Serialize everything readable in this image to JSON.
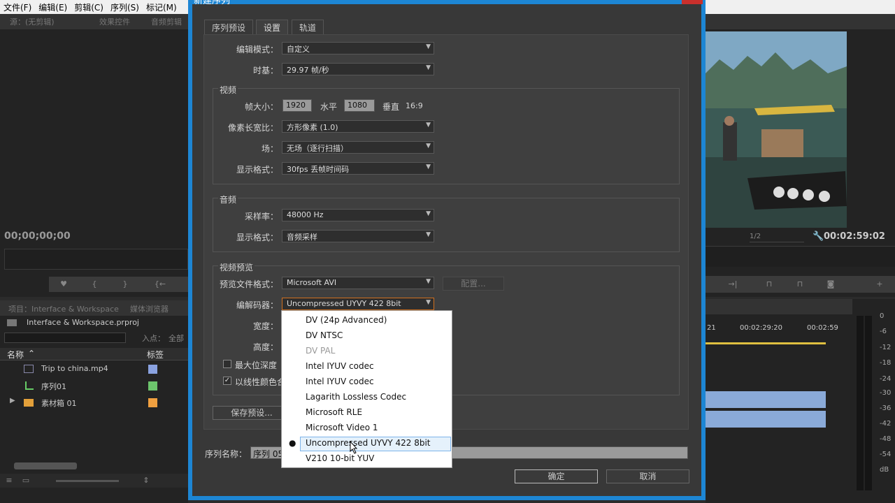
{
  "menubar": {
    "items": [
      "文件(F)",
      "编辑(E)",
      "剪辑(C)",
      "序列(S)",
      "标记(M)"
    ]
  },
  "source_panel": {
    "tab_source": "源：(无剪辑)",
    "tab_effects": "效果控件",
    "tab_audio": "音频剪辑",
    "timecode": "00;00;00;00"
  },
  "project_panel": {
    "tab_project": "项目：Interface & Workspace",
    "tab_media": "媒体浏览器",
    "file_name": "Interface & Workspace.prproj",
    "in_point_label": "入点：",
    "in_point_value": "全部",
    "col_name": "名称",
    "col_label": "标签",
    "items": [
      {
        "name": "Trip to china.mp4",
        "color": "#8aa2e0"
      },
      {
        "name": "序列01",
        "color": "#6cc46c"
      },
      {
        "name": "素材箱 01",
        "color": "#f0a040"
      }
    ]
  },
  "dialog": {
    "title": "新建序列",
    "tabs": [
      "序列预设",
      "设置",
      "轨道"
    ],
    "edit_mode_label": "编辑模式：",
    "edit_mode_value": "自定义",
    "timebase_label": "时基：",
    "timebase_value": "29.97 帧/秒",
    "video_group": "视频",
    "frame_size_label": "帧大小：",
    "frame_width": "1920",
    "horizontal_label": "水平",
    "frame_height": "1080",
    "vertical_label": "垂直",
    "aspect": "16:9",
    "pixel_aspect_label": "像素长宽比：",
    "pixel_aspect_value": "方形像素 (1.0)",
    "fields_label": "场：",
    "fields_value": "无场（逐行扫描）",
    "display_format_label": "显示格式：",
    "display_format_value": "30fps 丢帧时间码",
    "audio_group": "音频",
    "sample_rate_label": "采样率：",
    "sample_rate_value": "48000 Hz",
    "audio_display_label": "显示格式：",
    "audio_display_value": "音频采样",
    "preview_group": "视频预览",
    "preview_format_label": "预览文件格式：",
    "preview_format_value": "Microsoft AVI",
    "configure_button": "配置...",
    "codec_label": "编解码器：",
    "codec_value": "Uncompressed UYVY 422 8bit",
    "width_label": "宽度：",
    "height_label": "高度：",
    "max_depth_label": "最大位深度",
    "linear_color_label": "以线性颜色合",
    "save_preset_button": "保存预设...",
    "seq_name_label": "序列名称：",
    "seq_name_value": "序列 05",
    "ok_button": "确定",
    "cancel_button": "取消"
  },
  "codec_dropdown": {
    "options": [
      {
        "label": "DV (24p Advanced)",
        "disabled": false
      },
      {
        "label": "DV NTSC",
        "disabled": false
      },
      {
        "label": "DV PAL",
        "disabled": true
      },
      {
        "label": "Intel IYUV codec",
        "disabled": false
      },
      {
        "label": "Intel IYUV codec",
        "disabled": false
      },
      {
        "label": "Lagarith Lossless Codec",
        "disabled": false
      },
      {
        "label": "Microsoft RLE",
        "disabled": false
      },
      {
        "label": "Microsoft Video 1",
        "disabled": false
      },
      {
        "label": "Uncompressed UYVY 422 8bit",
        "disabled": false,
        "selected": true
      },
      {
        "label": "V210 10-bit YUV",
        "disabled": false
      }
    ]
  },
  "program_panel": {
    "timecode": "00:02:59:02",
    "zoom": "1/2",
    "timeline_t1": "21",
    "timeline_t2": "00:02:29:20",
    "timeline_t3": "00:02:59"
  },
  "audio_meter": {
    "labels": [
      "0",
      "-6",
      "-12",
      "-18",
      "-24",
      "-30",
      "-36",
      "-42",
      "-48",
      "-54",
      "dB"
    ]
  }
}
